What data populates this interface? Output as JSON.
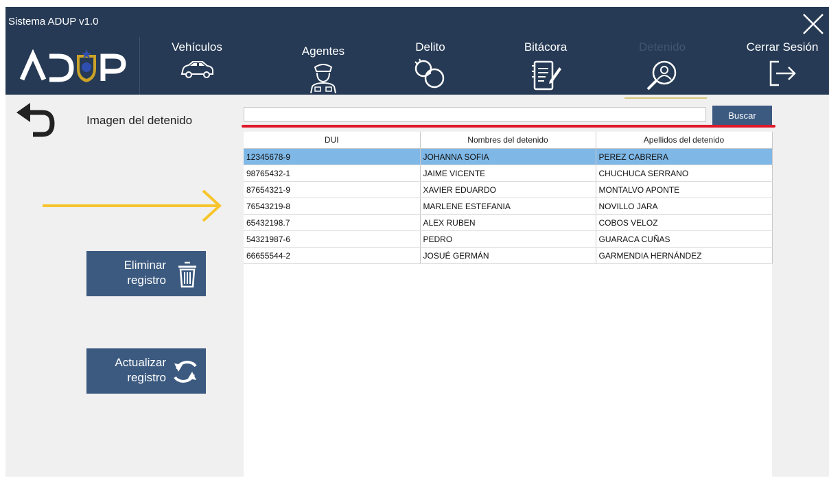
{
  "app": {
    "title": "Sistema ADUP v1.0"
  },
  "nav": [
    {
      "label": "Vehículos",
      "icon": "car-icon",
      "active": false
    },
    {
      "label": "Agentes",
      "icon": "police-agent-icon",
      "active": false
    },
    {
      "label": "Delito",
      "icon": "handcuffs-icon",
      "active": false
    },
    {
      "label": "Bitácora",
      "icon": "logbook-icon",
      "active": false
    },
    {
      "label": "Detenido",
      "icon": "detainee-search-icon",
      "active": true
    },
    {
      "label": "Cerrar Sesión",
      "icon": "logout-icon",
      "active": false
    }
  ],
  "left": {
    "image_label": "Imagen del detenido",
    "delete_button": {
      "line1": "Eliminar",
      "line2": "registro"
    },
    "update_button": {
      "line1": "Actualizar",
      "line2": "registro"
    }
  },
  "search": {
    "value": "",
    "placeholder": "",
    "button_label": "Buscar"
  },
  "table": {
    "columns": [
      "DUI",
      "Nombres del detenido",
      "Apellidos del detenido"
    ],
    "rows": [
      [
        "12345678-9",
        "JOHANNA SOFIA",
        "PEREZ CABRERA"
      ],
      [
        "98765432-1",
        "JAIME VICENTE",
        "CHUCHUCA SERRANO"
      ],
      [
        "87654321-9",
        "XAVIER EDUARDO",
        "MONTALVO APONTE"
      ],
      [
        "76543219-8",
        "MARLENE ESTEFANIA",
        "NOVILLO JARA"
      ],
      [
        "65432198.7",
        "ALEX RUBEN",
        "COBOS VELOZ"
      ],
      [
        "54321987-6",
        "PEDRO",
        "GUARACA CUÑAS"
      ],
      [
        "66655544-2",
        "JOSUÉ GERMÁN",
        "GARMENDIA HERNÁNDEZ"
      ]
    ],
    "selected_row": 0
  },
  "colors": {
    "header_bg": "#263a55",
    "button_bg": "#3c5a80",
    "selection": "#7fb8e6",
    "annotation_red": "#e0192a",
    "annotation_yellow": "#f7c52b",
    "logo_gold": "#c9a227"
  }
}
